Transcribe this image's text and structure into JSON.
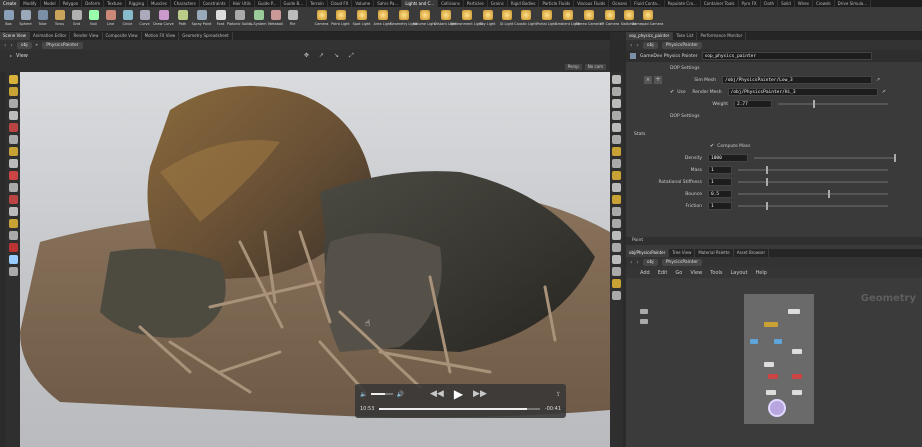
{
  "shelf_tabs": [
    "Create",
    "Modify",
    "Model",
    "Polygon",
    "Deform",
    "Texture",
    "Rigging",
    "Muscles",
    "Characters",
    "Constraints",
    "Hair Utils",
    "Guide P...",
    "Guide B...",
    "Terrain",
    "Cloud FX",
    "Volume",
    "Sahrs Pa...",
    "Lights and C...",
    "Collisions",
    "Particles",
    "Grains",
    "Rigid Bodies",
    "Particle Fluids",
    "Viscous Fluids",
    "Oceans",
    "Fluid Conta...",
    "Populate Cro...",
    "Container Tools",
    "Pyro FX",
    "Cloth",
    "Solid",
    "Wires",
    "Crowds",
    "Drive Simula..."
  ],
  "shelf_tools_left": [
    "Box",
    "Sphere",
    "Tube",
    "Torus",
    "Grid",
    "Null",
    "Line",
    "Circle",
    "Curve",
    "Draw Curve",
    "Path",
    "Spray Paint",
    "Font",
    "Platonic Solids",
    "L-System",
    "Metaball",
    "File"
  ],
  "shelf_tools_right": [
    "Camera",
    "Point Light",
    "Spot Light",
    "Area Light",
    "Geometry Light",
    "Volume Light",
    "Distant Light",
    "Environment Light",
    "Sky Light",
    "GI Light",
    "Caustic Light",
    "Portal Light",
    "Ambient Light",
    "Stereo Camera",
    "VR Camera",
    "Switcher",
    "Gamepad Camera"
  ],
  "left_pane_tabs": [
    "Scene View",
    "Animation Editor",
    "Render View",
    "Composite View",
    "Motion FX View",
    "Geometry Spreadsheet"
  ],
  "left_path": {
    "obj": "obj",
    "node": "PhysicsPainter"
  },
  "viewport": {
    "label": "View",
    "persp": "Persp",
    "cam": "No cam"
  },
  "media": {
    "current": "10:53",
    "remaining": "-00:41",
    "progress": 0.92,
    "volume": 0.6
  },
  "right_top_tabs": [
    "sop_physics_painter",
    "Take List",
    "Performance Monitor"
  ],
  "right_path": {
    "obj": "obj",
    "node": "PhysicsPainter"
  },
  "params": {
    "node_type": "GameDev Physics Painter",
    "node_name": "sop_physics_painter",
    "dop_settings_1": "DOP Settings",
    "sim_mesh_label": "Sim Mesh",
    "sim_mesh_value": "/obj/PhysicsPainter/Low_3",
    "use_label": "Use",
    "render_mesh_label": "Render Mesh",
    "render_mesh_value": "/obj/PhysicsPainter/Hi_3",
    "weight_label": "Weight",
    "weight_value": "2.77",
    "dop_settings_2": "DOP Settings",
    "stats": "Stats",
    "compute_mass": "Compute Mass",
    "density_label": "Density",
    "density_value": "1000",
    "mass_label": "Mass",
    "mass_value": "1",
    "rot_label": "Rotational Stiffness",
    "rot_value": "1",
    "bounce_label": "Bounce",
    "bounce_value": "0.5",
    "friction_label": "Friction",
    "friction_value": "1",
    "point": "Point"
  },
  "net_tabs": [
    "obj/PhysicsPainter",
    "Tree View",
    "Material Palette",
    "Asset Browser"
  ],
  "net_path": {
    "obj": "obj",
    "node": "PhysicsPainter"
  },
  "net_menu": [
    "Add",
    "Edit",
    "Go",
    "View",
    "Tools",
    "Layout",
    "Help"
  ],
  "net_label": "Geometry"
}
